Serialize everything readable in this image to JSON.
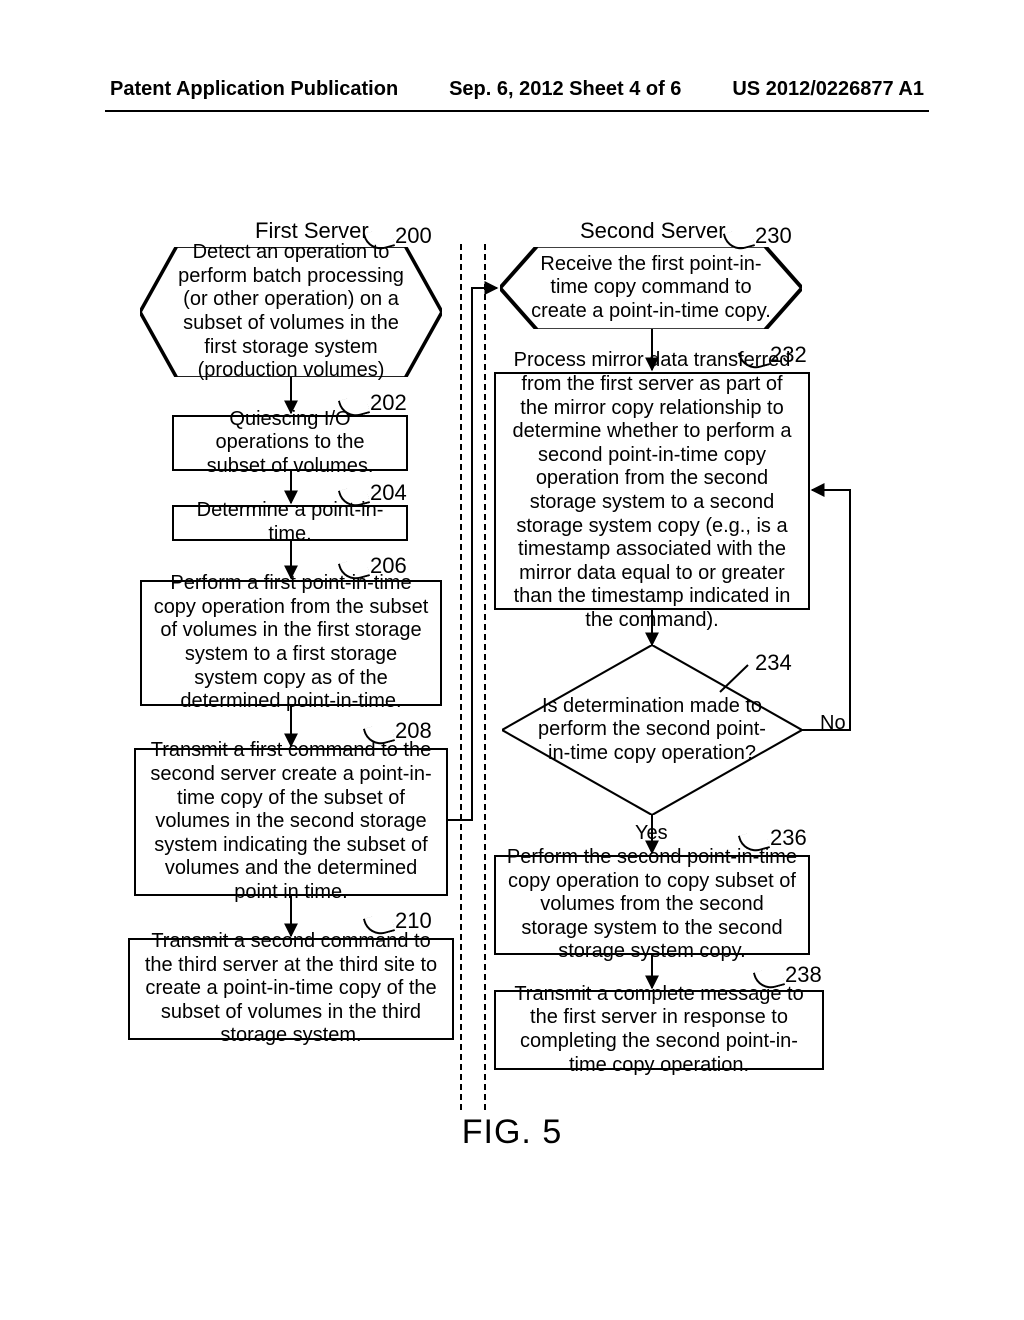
{
  "header": {
    "left": "Patent Application Publication",
    "center": "Sep. 6, 2012   Sheet 4 of 6",
    "right": "US 2012/0226877 A1"
  },
  "columns": {
    "left_title": "First Server",
    "right_title": "Second Server"
  },
  "left": {
    "hex200": "Detect an operation to perform batch processing (or other operation) on a subset of volumes in the first storage system (production volumes)",
    "b202": "Quiescing I/O operations to the subset of volumes.",
    "b204": "Determine a point-in-time.",
    "b206": "Perform a first point-in-time copy operation from the subset of volumes in the first storage system to a first storage system copy as of the determined point-in-time.",
    "b208": "Transmit a first command to the second server create a point-in-time copy of the subset of volumes in the second storage system indicating the subset of volumes and the determined point in time.",
    "b210": "Transmit a second command to the third server at the third site to create a point-in-time copy of the subset of volumes in the third storage system."
  },
  "right": {
    "hex230": "Receive the first point-in-time copy command to create a point-in-time copy.",
    "b232": "Process mirror data transferred from the first server as part of the mirror copy relationship to determine whether to perform a second point-in-time copy operation from the second storage system to a second storage system copy (e.g., is a timestamp associated with the mirror data equal to or greater than the timestamp indicated in the command).",
    "d234": "Is determination made to perform the second point-in-time copy operation?",
    "b236": "Perform the second point-in-time copy operation to copy subset of volumes from the second storage system to the second storage system copy.",
    "b238": "Transmit a complete message to the first server in response to completing the second point-in-time copy operation."
  },
  "labels": {
    "yes": "Yes",
    "no": "No",
    "fig": "FIG. 5"
  },
  "refs": {
    "r200": "200",
    "r202": "202",
    "r204": "204",
    "r206": "206",
    "r208": "208",
    "r210": "210",
    "r230": "230",
    "r232": "232",
    "r234": "234",
    "r236": "236",
    "r238": "238"
  }
}
